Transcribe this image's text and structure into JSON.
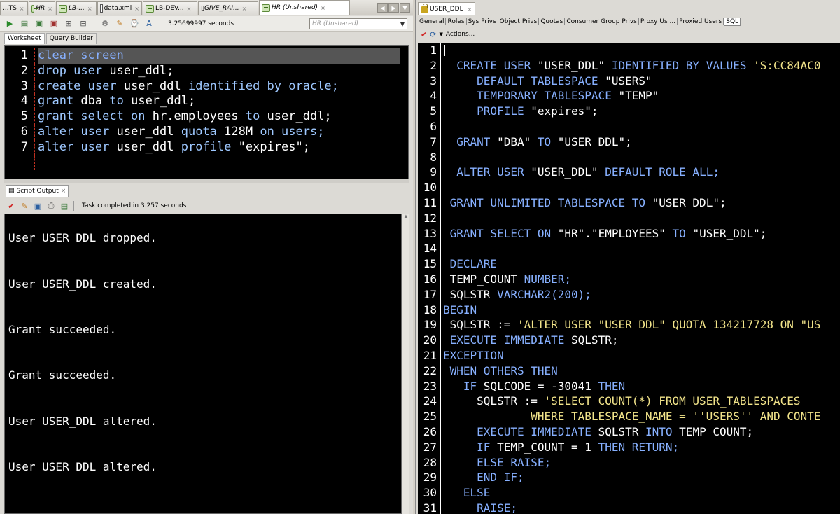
{
  "left": {
    "tabs": [
      {
        "label": "...TS",
        "icon": "none",
        "active": false
      },
      {
        "label": "HR",
        "icon": "db",
        "italic": true,
        "active": false
      },
      {
        "label": "LB-...",
        "icon": "db",
        "italic": true,
        "active": false
      },
      {
        "label": "data.xml",
        "icon": "file",
        "active": false
      },
      {
        "label": "LB-DEV...",
        "icon": "db",
        "active": false
      },
      {
        "label": "GIVE_RAI...",
        "icon": "code",
        "italic": true,
        "active": false
      },
      {
        "label": "HR (Unshared)",
        "icon": "db",
        "active": true
      }
    ],
    "toolbar": {
      "timing": "3.25699997 seconds",
      "connection": "HR (Unshared)"
    },
    "subtabs": {
      "worksheet": "Worksheet",
      "query_builder": "Query Builder"
    },
    "editor_lines": [
      {
        "n": "1",
        "parts": [
          {
            "t": "clear screen",
            "c": "kw"
          }
        ]
      },
      {
        "n": "2",
        "parts": [
          {
            "t": "drop user ",
            "c": "kw2"
          },
          {
            "t": "user_ddl;",
            "c": ""
          }
        ]
      },
      {
        "n": "3",
        "parts": [
          {
            "t": "create user ",
            "c": "kw2"
          },
          {
            "t": "user_ddl ",
            "c": ""
          },
          {
            "t": "identified by ",
            "c": "kw2"
          },
          {
            "t": "oracle;",
            "c": "kw2"
          }
        ]
      },
      {
        "n": "4",
        "parts": [
          {
            "t": "grant ",
            "c": "kw2"
          },
          {
            "t": "dba ",
            "c": ""
          },
          {
            "t": "to ",
            "c": "kw2"
          },
          {
            "t": "user_ddl;",
            "c": ""
          }
        ]
      },
      {
        "n": "5",
        "parts": [
          {
            "t": "grant select on ",
            "c": "kw2"
          },
          {
            "t": "hr.employees ",
            "c": ""
          },
          {
            "t": "to ",
            "c": "kw2"
          },
          {
            "t": "user_ddl;",
            "c": ""
          }
        ]
      },
      {
        "n": "6",
        "parts": [
          {
            "t": "alter user ",
            "c": "kw2"
          },
          {
            "t": "user_ddl ",
            "c": ""
          },
          {
            "t": "quota ",
            "c": "kw2"
          },
          {
            "t": "128M ",
            "c": ""
          },
          {
            "t": "on users;",
            "c": "kw2"
          }
        ]
      },
      {
        "n": "7",
        "parts": [
          {
            "t": "alter user ",
            "c": "kw2"
          },
          {
            "t": "user_ddl ",
            "c": ""
          },
          {
            "t": "profile ",
            "c": "kw2"
          },
          {
            "t": "\"expires\";",
            "c": ""
          }
        ]
      }
    ],
    "output_tab": "Script Output",
    "output_status": "Task completed in 3.257 seconds",
    "output_lines": [
      "User USER_DDL dropped.",
      "User USER_DDL created.",
      "Grant succeeded.",
      "Grant succeeded.",
      "User USER_DDL altered.",
      "User USER_DDL altered."
    ]
  },
  "right": {
    "tab": "USER_DDL",
    "subtabs": [
      "General",
      "Roles",
      "Sys Privs",
      "Object Privs",
      "Quotas",
      "Consumer Group Privs",
      "Proxy Us ...",
      "Proxied Users",
      "SQL"
    ],
    "active_subtab": "SQL",
    "actions_label": "Actions...",
    "code_lines": [
      {
        "n": "1",
        "parts": []
      },
      {
        "n": "2",
        "parts": [
          {
            "t": "  CREATE USER ",
            "c": "rk"
          },
          {
            "t": "\"USER_DDL\" ",
            "c": ""
          },
          {
            "t": "IDENTIFIED BY VALUES ",
            "c": "rk"
          },
          {
            "t": "'S:CC84AC0",
            "c": "rs"
          }
        ]
      },
      {
        "n": "3",
        "parts": [
          {
            "t": "     DEFAULT TABLESPACE ",
            "c": "rk"
          },
          {
            "t": "\"USERS\"",
            "c": ""
          }
        ]
      },
      {
        "n": "4",
        "parts": [
          {
            "t": "     TEMPORARY TABLESPACE ",
            "c": "rk"
          },
          {
            "t": "\"TEMP\"",
            "c": ""
          }
        ]
      },
      {
        "n": "5",
        "parts": [
          {
            "t": "     PROFILE ",
            "c": "rk"
          },
          {
            "t": "\"expires\";",
            "c": ""
          }
        ]
      },
      {
        "n": "6",
        "parts": []
      },
      {
        "n": "7",
        "parts": [
          {
            "t": "  GRANT ",
            "c": "rk"
          },
          {
            "t": "\"DBA\" ",
            "c": ""
          },
          {
            "t": "TO ",
            "c": "rk"
          },
          {
            "t": "\"USER_DDL\";",
            "c": ""
          }
        ]
      },
      {
        "n": "8",
        "parts": []
      },
      {
        "n": "9",
        "parts": [
          {
            "t": "  ALTER USER ",
            "c": "rk"
          },
          {
            "t": "\"USER_DDL\" ",
            "c": ""
          },
          {
            "t": "DEFAULT ROLE ALL;",
            "c": "rk"
          }
        ]
      },
      {
        "n": "10",
        "parts": []
      },
      {
        "n": "11",
        "parts": [
          {
            "t": " GRANT UNLIMITED TABLESPACE TO ",
            "c": "rk"
          },
          {
            "t": "\"USER_DDL\";",
            "c": ""
          }
        ]
      },
      {
        "n": "12",
        "parts": []
      },
      {
        "n": "13",
        "parts": [
          {
            "t": " GRANT SELECT ON ",
            "c": "rk"
          },
          {
            "t": "\"HR\".\"EMPLOYEES\" ",
            "c": ""
          },
          {
            "t": "TO ",
            "c": "rk"
          },
          {
            "t": "\"USER_DDL\";",
            "c": ""
          }
        ]
      },
      {
        "n": "14",
        "parts": []
      },
      {
        "n": "15",
        "parts": [
          {
            "t": " DECLARE",
            "c": "rk"
          }
        ]
      },
      {
        "n": "16",
        "parts": [
          {
            "t": " TEMP_COUNT ",
            "c": ""
          },
          {
            "t": "NUMBER;",
            "c": "rk"
          }
        ]
      },
      {
        "n": "17",
        "parts": [
          {
            "t": " SQLSTR ",
            "c": ""
          },
          {
            "t": "VARCHAR2(200);",
            "c": "rk"
          }
        ]
      },
      {
        "n": "18",
        "parts": [
          {
            "t": "BEGIN",
            "c": "rk"
          }
        ]
      },
      {
        "n": "19",
        "parts": [
          {
            "t": " SQLSTR := ",
            "c": ""
          },
          {
            "t": "'ALTER USER \"USER_DDL\" QUOTA 134217728 ON \"US",
            "c": "rs"
          }
        ]
      },
      {
        "n": "20",
        "parts": [
          {
            "t": " EXECUTE IMMEDIATE ",
            "c": "rk"
          },
          {
            "t": "SQLSTR;",
            "c": ""
          }
        ]
      },
      {
        "n": "21",
        "parts": [
          {
            "t": "EXCEPTION",
            "c": "rk"
          }
        ]
      },
      {
        "n": "22",
        "parts": [
          {
            "t": " WHEN OTHERS THEN",
            "c": "rk"
          }
        ]
      },
      {
        "n": "23",
        "parts": [
          {
            "t": "   IF ",
            "c": "rk"
          },
          {
            "t": "SQLCODE = ",
            "c": ""
          },
          {
            "t": "-30041 ",
            "c": ""
          },
          {
            "t": "THEN",
            "c": "rk"
          }
        ]
      },
      {
        "n": "24",
        "parts": [
          {
            "t": "     SQLSTR := ",
            "c": ""
          },
          {
            "t": "'SELECT COUNT(*) FROM USER_TABLESPACES",
            "c": "rs"
          }
        ]
      },
      {
        "n": "25",
        "parts": [
          {
            "t": "             WHERE TABLESPACE_NAME = ''USERS'' AND CONTE",
            "c": "rs"
          }
        ]
      },
      {
        "n": "26",
        "parts": [
          {
            "t": "     EXECUTE IMMEDIATE ",
            "c": "rk"
          },
          {
            "t": "SQLSTR ",
            "c": ""
          },
          {
            "t": "INTO ",
            "c": "rk"
          },
          {
            "t": "TEMP_COUNT;",
            "c": ""
          }
        ]
      },
      {
        "n": "27",
        "parts": [
          {
            "t": "     IF ",
            "c": "rk"
          },
          {
            "t": "TEMP_COUNT = 1 ",
            "c": ""
          },
          {
            "t": "THEN RETURN;",
            "c": "rk"
          }
        ]
      },
      {
        "n": "28",
        "parts": [
          {
            "t": "     ELSE RAISE;",
            "c": "rk"
          }
        ]
      },
      {
        "n": "29",
        "parts": [
          {
            "t": "     END IF;",
            "c": "rk"
          }
        ]
      },
      {
        "n": "30",
        "parts": [
          {
            "t": "   ELSE",
            "c": "rk"
          }
        ]
      },
      {
        "n": "31",
        "parts": [
          {
            "t": "     RAISE;",
            "c": "rk"
          }
        ]
      }
    ]
  }
}
